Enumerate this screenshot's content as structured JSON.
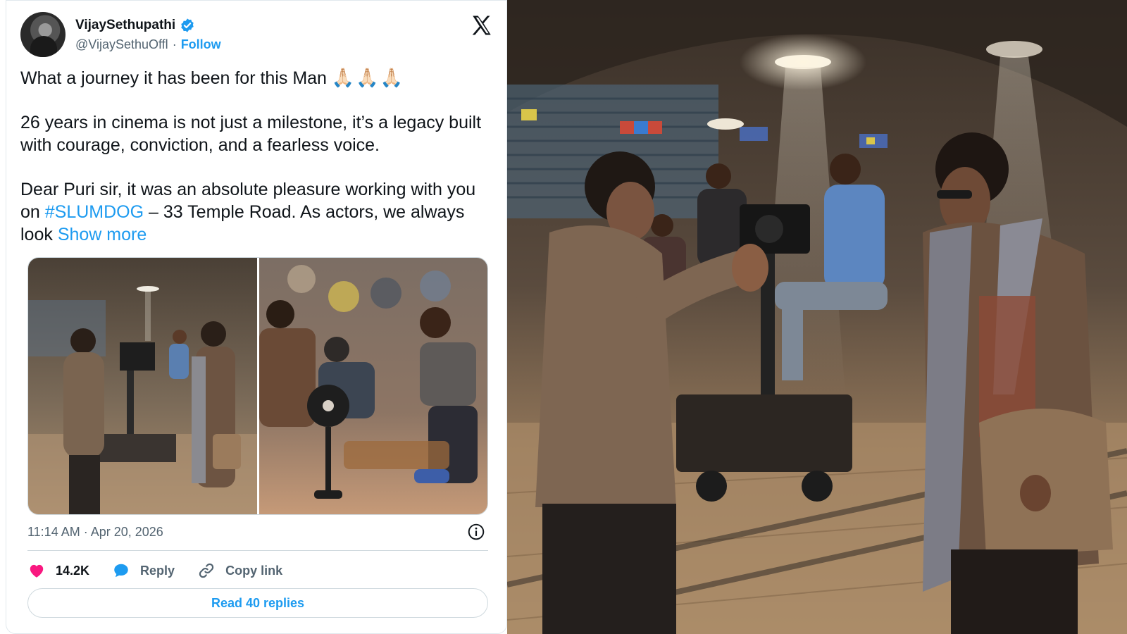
{
  "tweet": {
    "author_name": "VijaySethupathi",
    "handle": "@VijaySethuOffl",
    "separator": "·",
    "follow_label": "Follow",
    "text_line1": "What a journey it has been for this Man",
    "emoji": "🙏🏻🙏🏻🙏🏻",
    "paragraph2": "26 years in cinema is not just a milestone, it’s a legacy built with courage, conviction, and a fearless voice.",
    "paragraph3_before": "Dear Puri sir, it was an absolute pleasure working with you on",
    "hashtag": "#SLUMDOG",
    "paragraph3_after": "– 33 Temple Road. As actors, we always look",
    "show_more_label": "Show more",
    "timestamp": "11:14 AM · Apr 20, 2026",
    "likes": "14.2K",
    "reply_label": "Reply",
    "copy_link_label": "Copy link",
    "read_replies_label": "Read 40 replies"
  },
  "icons": {
    "verified": "verified-badge-icon",
    "x_logo": "x-logo-icon",
    "info": "info-icon",
    "like": "heart-icon",
    "reply": "speech-bubble-icon",
    "copy_link": "link-icon"
  },
  "colors": {
    "accent": "#1d9bf0",
    "like": "#f91880",
    "text": "#0f1419",
    "secondary": "#536471",
    "border": "#cfd9de"
  }
}
